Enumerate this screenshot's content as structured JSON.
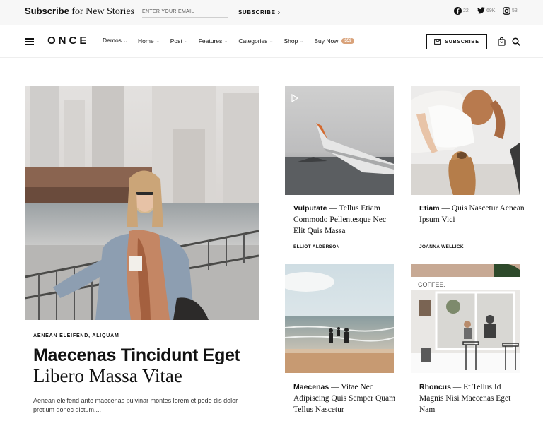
{
  "topbar": {
    "title_bold": "Subscribe",
    "title_serif": " for New Stories",
    "email_placeholder": "ENTER YOUR EMAIL",
    "subscribe_label": "SUBSCRIBE",
    "social": {
      "facebook_count": "22",
      "twitter_count": "69K",
      "instagram_count": "53"
    }
  },
  "nav": {
    "logo": "ONCE",
    "items": [
      {
        "label": "Demos",
        "caret": true
      },
      {
        "label": "Home",
        "caret": true
      },
      {
        "label": "Post",
        "caret": true
      },
      {
        "label": "Features",
        "caret": true
      },
      {
        "label": "Categories",
        "caret": true
      },
      {
        "label": "Shop",
        "caret": true
      },
      {
        "label": "Buy Now",
        "caret": false,
        "badge": "$59"
      }
    ],
    "subscribe_label": "SUBSCRIBE"
  },
  "featured": {
    "cat1": "AENEAN ELEIFEND",
    "cat2": "ALIQUAM",
    "title_bold": "Maecenas Tincidunt Eget",
    "title_serif": "Libero Massa Vitae",
    "excerpt": "Aenean eleifend ante maecenas pulvinar montes lorem et pede dis dolor pretium donec dictum...."
  },
  "cards": [
    {
      "title_bold": "Vulputate",
      "title_rest": " — Tellus Etiam Commodo Pellentesque Nec Elit Quis Massa",
      "author": "ELLIOT ALDERSON"
    },
    {
      "title_bold": "Etiam",
      "title_rest": " — Quis Nascetur Aenean Ipsum Vici",
      "author": "JOANNA WELLICK"
    },
    {
      "title_bold": "Maecenas",
      "title_rest": " — Vitae Nec Adipiscing Quis Semper Quam Tellus Nascetur",
      "author": ""
    },
    {
      "title_bold": "Rhoncus",
      "title_rest": " — Et Tellus Id Magnis Nisi Maecenas Eget Nam",
      "author": ""
    }
  ],
  "photo_text": {
    "cafe_sign": "COFFEE."
  },
  "colors": {
    "topbar_bg": "#f7f7f7",
    "badge": "#d9a27a"
  }
}
